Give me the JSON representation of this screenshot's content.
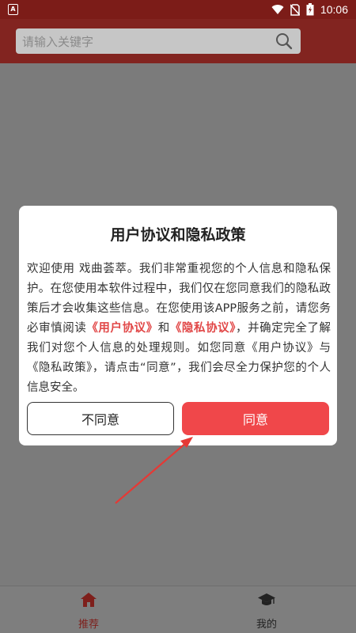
{
  "status_bar": {
    "left_icon": "A",
    "time": "10:06",
    "battery_glyph": "battery-charging-icon",
    "colors": {
      "background": "#7c1c18"
    }
  },
  "header": {
    "search": {
      "placeholder": "请输入关键字",
      "icon": "search-icon"
    },
    "colors": {
      "background": "#822420"
    }
  },
  "dialog": {
    "title": "用户协议和隐私政策",
    "body": {
      "text_1": "欢迎使用 戏曲荟萃。我们非常重视您的个人信息和隐私保护。在您使用本软件过程中，我们仅在您同意我们的隐私政策后才会收集这些信息。在您使用该APP服务之前，请您务必审慎阅读",
      "link_1": "《用户协议》",
      "text_2": "和",
      "link_2": "《隐私协议》",
      "text_3": "，并确定完全了解我们对您个人信息的处理规则。如您同意《用户协议》与《隐私政策》，请点击“同意”，我们会尽全力保护您的个人信息安全。"
    },
    "buttons": {
      "disagree": "不同意",
      "agree": "同意"
    },
    "colors": {
      "link": "#e14747",
      "agree": "#f0474a"
    }
  },
  "bottom_nav": {
    "items": [
      {
        "label": "推荐",
        "icon": "home-icon",
        "active": true
      },
      {
        "label": "我的",
        "icon": "graduation-cap-icon",
        "active": false
      }
    ],
    "colors": {
      "active": "#7e1f1b"
    }
  }
}
